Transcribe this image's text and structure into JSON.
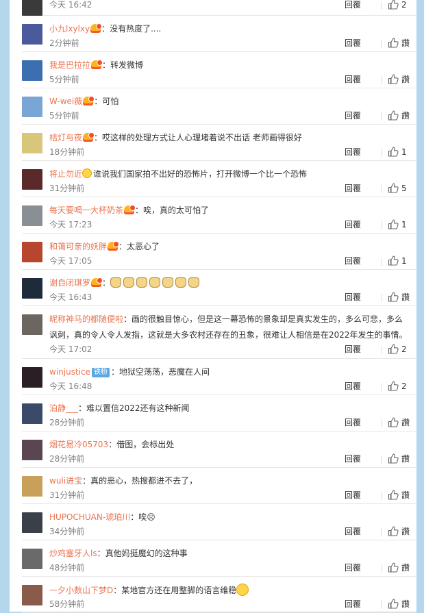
{
  "actions": {
    "reply_label": "回覆"
  },
  "comments": [
    {
      "user": "",
      "text": "",
      "time": "今天 16:42",
      "likes": "2",
      "avatar_color": "#3a3a3a"
    },
    {
      "user": "小九lxylxy",
      "badge": true,
      "text": "：没有热度了....",
      "time": "2分钟前",
      "likes": "讚",
      "avatar_color": "#4a5a9a"
    },
    {
      "user": "我是巴拉拉",
      "badge": true,
      "text": "：转发微博",
      "time": "5分钟前",
      "likes": "讚",
      "avatar_color": "#3b6fb0"
    },
    {
      "user": "W-wei薇",
      "badge": true,
      "text": "：可怕",
      "time": "5分钟前",
      "likes": "讚",
      "avatar_color": "#7aa6d6"
    },
    {
      "user": "桔灯与夜",
      "badge": true,
      "text": "：哎这样的处理方式让人心理堵着说不出话 老师画得很好",
      "time": "18分钟前",
      "likes": "1",
      "avatar_color": "#d8c67a"
    },
    {
      "user": "将止勿近",
      "emoji_before": true,
      "text": "谁说我们国家拍不出好的恐怖片，打开微博一个比一个恐怖",
      "time": "31分钟前",
      "likes": "5",
      "avatar_color": "#5a2a2a"
    },
    {
      "user": "每天要喝一大杯奶茶",
      "badge": true,
      "text": "：唉，真的太可怕了",
      "time": "今天 17:23",
      "likes": "1",
      "avatar_color": "#8a8f96"
    },
    {
      "user": "和蔼可亲的妖胖",
      "badge": true,
      "text": "：太恶心了",
      "time": "今天 17:05",
      "likes": "1",
      "avatar_color": "#b8452e"
    },
    {
      "user": "谢自闭琪罗",
      "badge": true,
      "text": "：",
      "cats": 7,
      "time": "今天 16:43",
      "likes": "讚",
      "avatar_color": "#1f2a3a"
    },
    {
      "user": "昵称神马的都随便啦",
      "text": "：画的很触目惊心，但是这一幕恐怖的景象却是真实发生的，多么可悲，多么讽刺，真的令人令人发指，这就是大多农村还存在的丑象，很难让人相信是在2022年发生的事情。",
      "time": "今天 17:02",
      "likes": "2",
      "avatar_color": "#6b6660"
    },
    {
      "user": "winjustice",
      "tag": "铁粉",
      "text": "：地狱空荡荡，恶魔在人间",
      "time": "今天 16:48",
      "likes": "2",
      "avatar_color": "#2a1f24"
    },
    {
      "user": "泊静___",
      "text": "：难以置信2022还有这种新闻",
      "time": "28分钟前",
      "likes": "讚",
      "avatar_color": "#3c4a6a"
    },
    {
      "user": "烟花易冷05703",
      "text": "：借图，会标出处",
      "time": "28分钟前",
      "likes": "讚",
      "avatar_color": "#5a4650"
    },
    {
      "user": "wuli进宝",
      "text": "：真的恶心，热搜都进不去了，",
      "time": "31分钟前",
      "likes": "讚",
      "avatar_color": "#c9a05a"
    },
    {
      "user": "HUPOCHUAN-琥珀川",
      "text": "：唉",
      "trail_symbol": "☹",
      "time": "34分钟前",
      "likes": "讚",
      "avatar_color": "#3a3f48"
    },
    {
      "user": "炒鸡塞牙人ls",
      "text": "：真他妈挺魔幻的这种事",
      "time": "48分钟前",
      "likes": "讚",
      "avatar_color": "#6a6a6a"
    },
    {
      "user": "一夕小数山下梦D",
      "text": "：某地官方还在用整脚的语言维稳",
      "emoji_after": true,
      "time": "58分钟前",
      "likes": "讚",
      "avatar_color": "#8a5a4a"
    }
  ]
}
